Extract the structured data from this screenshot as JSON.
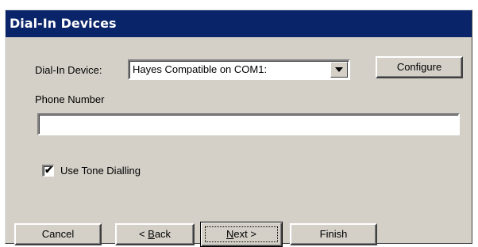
{
  "window": {
    "title": "Dial-In Devices"
  },
  "device": {
    "label": "Dial-In Device:",
    "selected": "Hayes Compatible on COM1:",
    "configure_label": "Configure"
  },
  "phone": {
    "label": "Phone Number",
    "value": ""
  },
  "tone": {
    "label": "Use Tone Dialling",
    "checked": true,
    "mark": "✔"
  },
  "buttons": {
    "cancel": "Cancel",
    "back_prefix": "< ",
    "back_accel": "B",
    "back_rest": "ack",
    "next_accel": "N",
    "next_rest": "ext >",
    "finish": "Finish"
  },
  "icons": {
    "dropdown": "chevron-down-icon",
    "check": "checkmark-icon"
  }
}
